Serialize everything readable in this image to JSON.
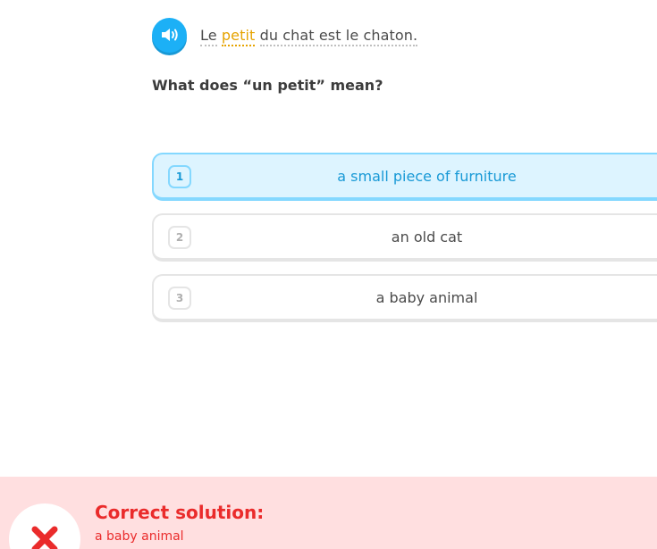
{
  "prompt": {
    "sentence_tokens": [
      {
        "text": "Le",
        "highlight": false
      },
      {
        "text": "petit",
        "highlight": true
      },
      {
        "text": "du chat est le chaton.",
        "highlight": false
      }
    ],
    "question": "What does “un petit” mean?",
    "speaker_icon": "speaker-icon",
    "highlight_color": "#e6a300"
  },
  "choices": [
    {
      "number": "1",
      "label": "a small piece of furniture",
      "selected": true
    },
    {
      "number": "2",
      "label": "an old cat",
      "selected": false
    },
    {
      "number": "3",
      "label": "a baby animal",
      "selected": false
    }
  ],
  "feedback": {
    "title": "Correct solution:",
    "answer": "a baby animal",
    "status": "incorrect",
    "icon": "x-icon",
    "color": "#ea2b2b",
    "background": "#ffdfe0"
  }
}
